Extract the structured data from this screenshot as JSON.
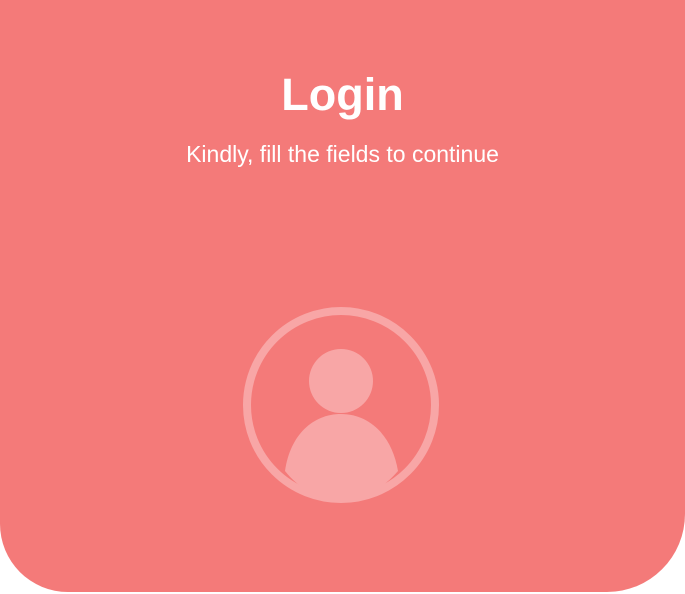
{
  "header": {
    "title": "Login",
    "subtitle": "Kindly, fill the fields to continue"
  },
  "avatar": {
    "icon": "user-circle-icon"
  },
  "colors": {
    "background": "#f47a79",
    "text": "#ffffff",
    "avatar_icon": "#f8a6a6"
  }
}
